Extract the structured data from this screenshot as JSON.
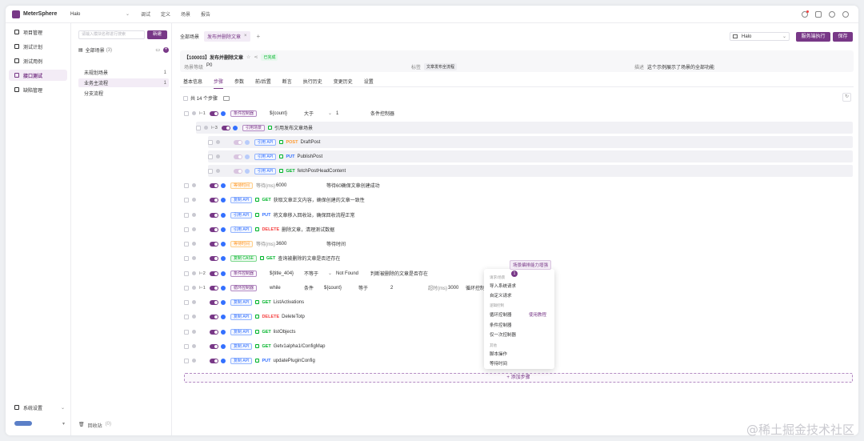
{
  "app": {
    "brand": "MeterSphere",
    "project": "Halo",
    "nav": [
      "调试",
      "定义",
      "场景",
      "报告"
    ]
  },
  "sidebar": {
    "items": [
      {
        "label": "项目管理",
        "icon": "folder-icon"
      },
      {
        "label": "测试计划",
        "icon": "plan-icon"
      },
      {
        "label": "测试用例",
        "icon": "case-icon"
      },
      {
        "label": "接口测试",
        "icon": "api-icon",
        "active": true
      },
      {
        "label": "缺陷管理",
        "icon": "bug-icon"
      }
    ],
    "settings": "系统设置"
  },
  "tree": {
    "search_placeholder": "请输入模块名称进行搜索",
    "new_button": "新建",
    "all_label": "全部场景",
    "all_count": "(3)",
    "nodes": [
      {
        "label": "未规划场景",
        "count": "1"
      },
      {
        "label": "业务主流程",
        "count": "1",
        "active": true
      },
      {
        "label": "分支流程",
        "count": ""
      }
    ],
    "recycle_label": "回收站",
    "recycle_count": "(0)"
  },
  "tabs": {
    "all": "全部场景",
    "active": "发布并删除文章",
    "close": "×",
    "add": "+"
  },
  "toolbar": {
    "env": "Halo",
    "run": "服务端执行",
    "save": "保存"
  },
  "header": {
    "id_title": "【100003】发布并删除文章",
    "status": "已完成",
    "priority_label": "场景等级",
    "priority": "P0",
    "tag_label": "标签",
    "tag": "文章发布全流程",
    "desc_label": "描述",
    "desc": "这个示例展示了场景的全部功能"
  },
  "subtabs": [
    "基本信息",
    "步骤",
    "参数",
    "前/后置",
    "断言",
    "执行历史",
    "变更历史",
    "设置"
  ],
  "steps_count": "共 14 个步骤",
  "steps": [
    {
      "num": "1",
      "tag": "条件控制器",
      "tag_color": "purple",
      "f1": "${count}",
      "f2": "大于",
      "f3": "1",
      "f4": "条件控制器"
    },
    {
      "num": "3",
      "tag": "引用场景",
      "tag_color": "purple",
      "name": "引用发布文章场景",
      "nested": true
    },
    {
      "num": "",
      "tag": "引用 API",
      "tag_color": "blue",
      "method": "POST",
      "name": "DraftPost",
      "nested": true,
      "light": true
    },
    {
      "num": "",
      "tag": "引用 API",
      "tag_color": "blue",
      "method": "PUT",
      "name": "PublishPost",
      "nested": true,
      "light": true
    },
    {
      "num": "",
      "tag": "引用 API",
      "tag_color": "blue",
      "method": "GET",
      "name": "fetchPostHeadContent",
      "nested": true,
      "light": true
    },
    {
      "num": "",
      "tag": "等待时间",
      "tag_color": "orange",
      "k": "等待(ms)",
      "v": "6000",
      "name": "等待60确保文章创建成功"
    },
    {
      "num": "",
      "tag": "复制 API",
      "tag_color": "blue",
      "method": "GET",
      "name": "获取文章正文内容，确保创建的文章一致性"
    },
    {
      "num": "",
      "tag": "引用 API",
      "tag_color": "blue",
      "method": "PUT",
      "name": "将文章移入回收站，确保回收流程正常"
    },
    {
      "num": "",
      "tag": "引用 API",
      "tag_color": "blue",
      "method": "DELETE",
      "name": "删除文章，清理测试数据"
    },
    {
      "num": "",
      "tag": "等待时间",
      "tag_color": "orange",
      "k": "等待(ms)",
      "v": "3600",
      "name": "等待时间"
    },
    {
      "num": "",
      "tag": "复制 CASE",
      "tag_color": "green",
      "method": "GET",
      "name": "查询被删除的文章是否还存在"
    },
    {
      "num": "2",
      "tag": "条件控制器",
      "tag_color": "purple",
      "f1": "${title_404}",
      "f2": "不等于",
      "f3": "Not Found",
      "f4": "判断被删除的文章是否存在"
    },
    {
      "num": "1",
      "tag": "循环控制器",
      "tag_color": "purple",
      "f1": "while",
      "f2": "条件",
      "f3": "${count}",
      "f3b": "等于",
      "f3c": "2",
      "f3d": "超时(ms)",
      "f3e": "3000",
      "f4": "循环控制"
    },
    {
      "num": "",
      "tag": "复制 API",
      "tag_color": "blue",
      "method": "GET",
      "name": "ListActivations"
    },
    {
      "num": "",
      "tag": "复制 API",
      "tag_color": "blue",
      "method": "DELETE",
      "name": "DeleteTotp"
    },
    {
      "num": "",
      "tag": "复制 API",
      "tag_color": "blue",
      "method": "GET",
      "name": "listObjects"
    },
    {
      "num": "",
      "tag": "复制 API",
      "tag_color": "blue",
      "method": "GET",
      "name": "Getv1alpha1/ConfigMap"
    },
    {
      "num": "",
      "tag": "复制 API",
      "tag_color": "blue",
      "method": "PUT",
      "name": "updatePluginConfig"
    }
  ],
  "add_step": "+ 添加步骤",
  "popover": {
    "title": "场景编排能力增强",
    "badge": "1",
    "groups": [
      {
        "label": "请求/场景",
        "items": [
          "导入系统请求",
          "自定义请求"
        ]
      },
      {
        "label": "逻辑控制",
        "items": [
          "循环控制器",
          "条件控制器",
          "仅一次控制器"
        ]
      },
      {
        "label": "其他",
        "items": [
          "脚本操作",
          "等待时间"
        ]
      }
    ],
    "tutorial": "使用教程"
  },
  "watermark": "@稀土掘金技术社区",
  "colors": {
    "brand": "#783887",
    "blue": "#3370ff",
    "green": "#00b42a",
    "orange": "#ff9a2e",
    "red": "#f53f3f"
  }
}
